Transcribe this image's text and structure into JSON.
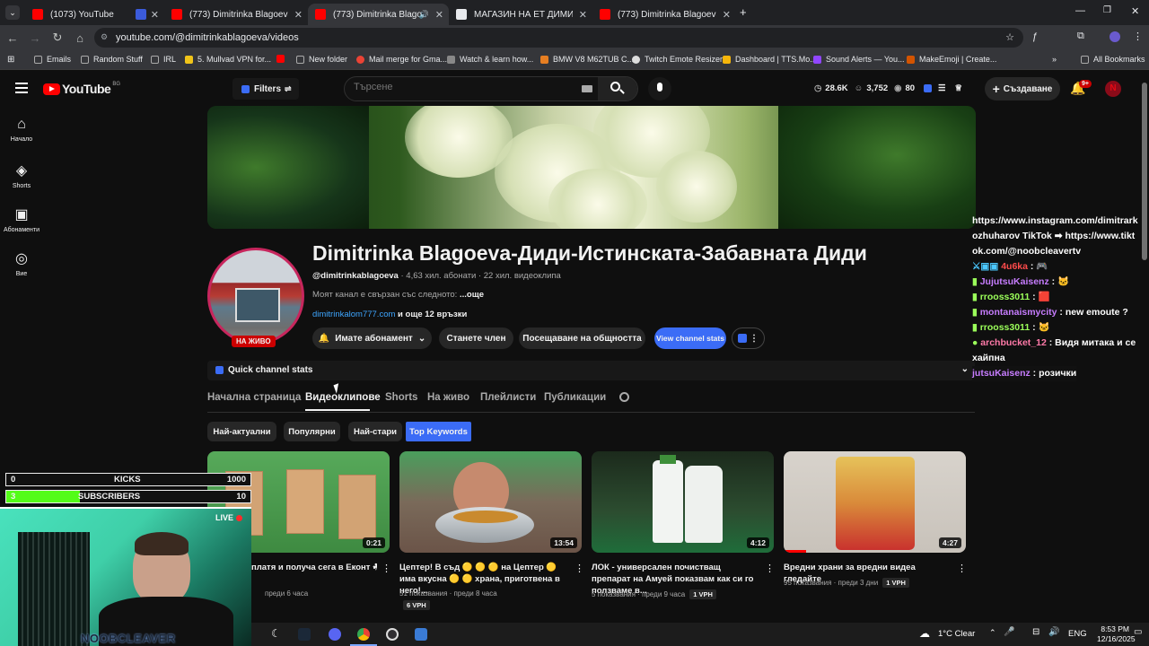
{
  "browser": {
    "tabs": [
      {
        "title": "(1073) YouTube",
        "color": "#ff0000"
      },
      {
        "title": "",
        "color": "#3b5bdb"
      },
      {
        "title": "(773) Dimitrinka Blagoeva-Диди",
        "color": "#ff0000"
      },
      {
        "title": "(773) Dimitrinka Blagoeva-Д",
        "color": "#ff0000"
      },
      {
        "title": "МАГАЗИН НА ЕТ ДИМИТРИН",
        "color": "#e8eaed"
      },
      {
        "title": "(773) Dimitrinka Blagoeva-Диди",
        "color": "#ff0000"
      }
    ],
    "url": "youtube.com/@dimitrinkablagoeva/videos",
    "bookmarks": [
      "Emails",
      "Random Stuff",
      "IRL",
      "5. Mullvad VPN for...",
      "New folder",
      "Mail merge for Gma...",
      "Watch & learn how...",
      "BMW V8 M62TUB C...",
      "Twitch Emote Resizer",
      "Dashboard | TTS.Mo...",
      "Sound Alerts — You...",
      "MakeEmoji | Create..."
    ],
    "all_bookmarks": "All Bookmarks"
  },
  "youtube": {
    "logo": "YouTube",
    "country": "BG",
    "filters": "Filters",
    "search_placeholder": "Търсене",
    "stats": {
      "views": "28.6K",
      "subs": "3,752",
      "count": "80"
    },
    "create": "Създаване",
    "notif_count": "9+",
    "sidebar": [
      "Начало",
      "Shorts",
      "Абонаменти",
      "Вие"
    ]
  },
  "channel": {
    "name": "Dimitrinka Blagoeva-Диди-Истинската-Забавната Диди",
    "handle": "@dimitrinkablagoeva",
    "meta": " · 4,63 хил. абонати · 22 хил. видеоклипа",
    "description": "Моят канал е свързан със следното: ",
    "more": "...още",
    "link": "dimitrinkalom777.com",
    "links_more": " и още 12 връзки",
    "live": "НА ЖИВО",
    "subscribed": "Имате абонамент",
    "join": "Станете член",
    "community": "Посещаване на общността",
    "view_stats": "View channel stats",
    "quick_stats": "Quick channel stats"
  },
  "nav_tabs": [
    "Начална страница",
    "Видеоклипове",
    "Shorts",
    "На живо",
    "Плейлисти",
    "Публикации"
  ],
  "filters": [
    "Най-актуални",
    "Популярни",
    "Най-стари",
    "Top Keywords"
  ],
  "videos": [
    {
      "duration": "0:21",
      "title": "платя и получа сега в Еконт ☘",
      "views": "",
      "age": "преди 6 часа",
      "vph": ""
    },
    {
      "duration": "13:54",
      "title": "Цептер! В съд 🟡 🟡 🟡 на Цептер 🟡 има вкусна 🟡 🟡 храна, приготвена в него!...",
      "views": "51 показвания",
      "age": "преди 8 часа",
      "vph": "6 VPH"
    },
    {
      "duration": "4:12",
      "title": "ЛОК - универсален почистващ препарат на Амуей показвам как си го ползваме в...",
      "views": "5 показвания",
      "age": "преди 9 часа",
      "vph": "1 VPH"
    },
    {
      "duration": "4:27",
      "title": "Вредни храни за вредни видеа гледайте",
      "views": "95 показвания",
      "age": "преди 3 дни",
      "vph": "1 VPH"
    }
  ],
  "chat": [
    {
      "user": "",
      "text": "https://www.instagram.com/dimitrarkozhuharov TikTok ➡ https://www.tiktok.com/@noobcleavertv",
      "color": "#ffffff"
    },
    {
      "user": "4u6ka",
      "text": " : 🎮",
      "color": "#ff4b4b"
    },
    {
      "user": "JujutsuKaisenz",
      "text": " : 🐱",
      "color": "#c77dff"
    },
    {
      "user": "rrooss3011",
      "text": " : 🟥",
      "color": "#9bff5a"
    },
    {
      "user": "montanaismycity",
      "text": " : new emoute ?",
      "color": "#c77dff"
    },
    {
      "user": "rrooss3011",
      "text": " : 🐱",
      "color": "#9bff5a"
    },
    {
      "user": "archbucket_12",
      "text": " : Видя митака и се хайпна",
      "color": "#ff7aa8"
    },
    {
      "user": "jutsuKaisenz",
      "text": " : розички",
      "color": "#c77dff"
    }
  ],
  "overlay": {
    "kicks_value": "0",
    "kicks_label": "KICKS",
    "kicks_goal": "1000",
    "subs_value": "3",
    "subs_label": "SUBSCRIBERS",
    "subs_goal": "10",
    "subs_progress": 0.3,
    "live_label": "LIVE",
    "streamer": "NOOBCLEAVER"
  },
  "taskbar": {
    "weather": "1°C  Clear",
    "lang": "ENG",
    "time": "8:53 PM",
    "date": "12/16/2025"
  }
}
